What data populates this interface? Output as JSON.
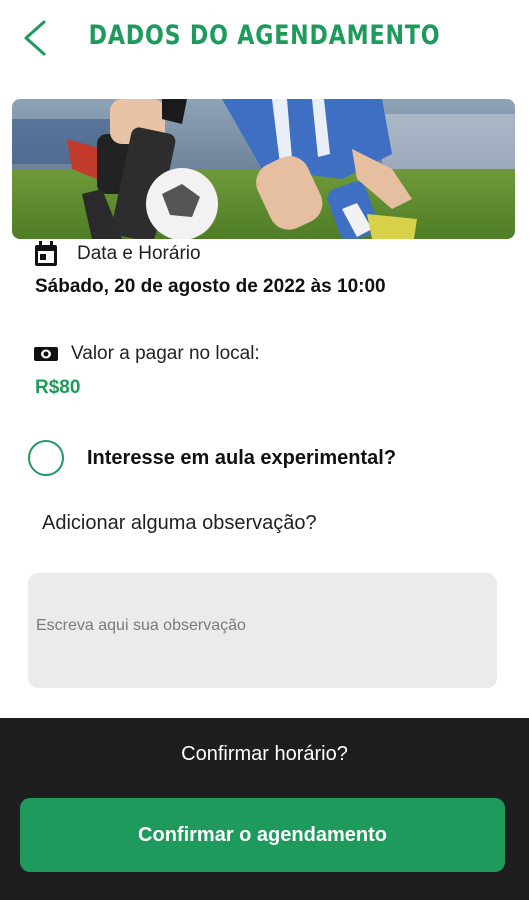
{
  "header": {
    "title": "DADOS DO AGENDAMENTO",
    "back_icon": "chevron-left-icon"
  },
  "hero": {
    "image": "soccer-players-photo"
  },
  "schedule": {
    "label": "Data e Horário",
    "value": "Sábado, 20 de agosto de 2022 às 10:00",
    "icon": "calendar-icon"
  },
  "payment": {
    "label": "Valor a pagar no local:",
    "value": "R$80",
    "icon": "cash-icon"
  },
  "trial": {
    "label": "Interesse em aula experimental?",
    "checked": false
  },
  "observation": {
    "label": "Adicionar alguma observação?",
    "placeholder": "Escreva aqui sua observação",
    "value": ""
  },
  "footer": {
    "question": "Confirmar horário?",
    "confirm_label": "Confirmar o agendamento"
  },
  "colors": {
    "accent": "#1e9a5c",
    "footer_bg": "#1e1e1e",
    "input_bg": "#ebebeb"
  }
}
